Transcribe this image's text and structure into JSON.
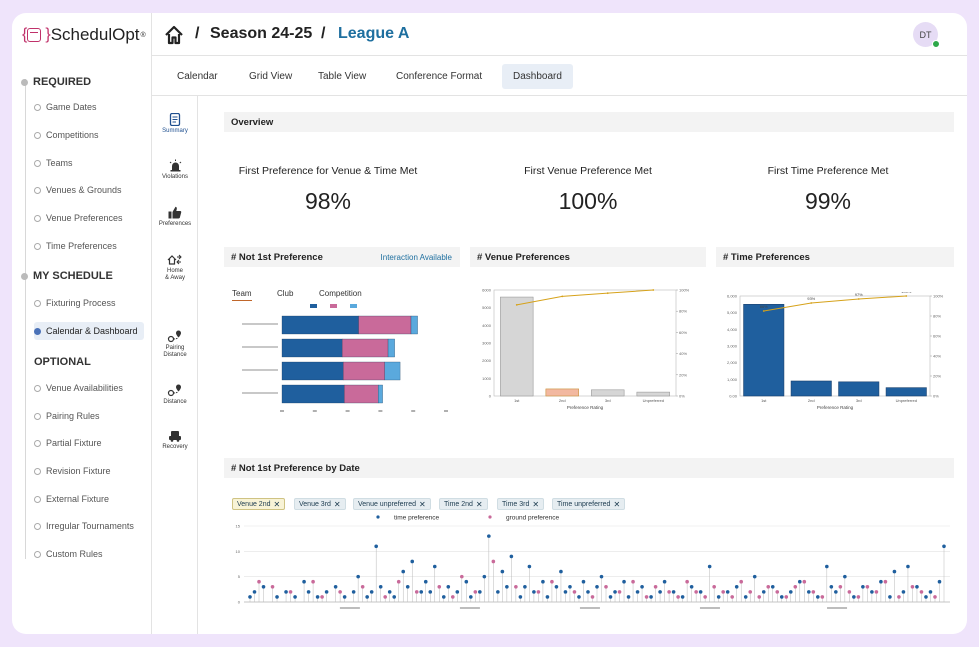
{
  "app": {
    "brand": "SchedulOpt",
    "brand_mark": "®"
  },
  "header": {
    "season": "Season 24-25",
    "league": "League A",
    "separator": "/",
    "avatar": "DT"
  },
  "sidebar": {
    "required_label": "REQUIRED",
    "required": [
      "Game Dates",
      "Competitions",
      "Teams",
      "Venues & Grounds",
      "Venue Preferences",
      "Time Preferences"
    ],
    "schedule_label": "MY SCHEDULE",
    "schedule": [
      "Fixturing Process",
      "Calendar & Dashboard"
    ],
    "optional_label": "OPTIONAL",
    "optional": [
      "Venue Availabilities",
      "Pairing Rules",
      "Partial Fixture",
      "Revision Fixture",
      "External Fixture",
      "Irregular Tournaments",
      "Custom Rules"
    ]
  },
  "tabs": [
    "Calendar",
    "Grid View",
    "Table View",
    "Conference Format",
    "Dashboard"
  ],
  "active_tab": "Dashboard",
  "vnav": [
    {
      "label": "Summary",
      "icon": "document-icon"
    },
    {
      "label": "Violations",
      "icon": "alarm-icon"
    },
    {
      "label": "Preferences",
      "icon": "thumbs-up-icon"
    },
    {
      "label": "Home & Away",
      "icon": "home-away-icon"
    },
    {
      "label": "Pairing Distance",
      "icon": "pairing-distance-icon"
    },
    {
      "label": "Distance",
      "icon": "distance-icon"
    },
    {
      "label": "Recovery",
      "icon": "recovery-icon"
    }
  ],
  "overview": {
    "title": "Overview",
    "kpis": [
      {
        "label": "First Preference for Venue & Time Met",
        "value": "98%"
      },
      {
        "label": "First Venue Preference Met",
        "value": "100%"
      },
      {
        "label": "First Time Preference Met",
        "value": "99%"
      }
    ]
  },
  "not_first": {
    "title": "# Not 1st Preference",
    "extra": "Interaction Available",
    "subtabs": [
      "Team",
      "Club",
      "Competition"
    ],
    "active_subtab": "Team"
  },
  "venue_pref": {
    "title": "# Venue Preferences",
    "xlabel": "Preference Rating"
  },
  "time_pref": {
    "title": "# Time Preferences",
    "xlabel": "Preference Rating"
  },
  "by_date": {
    "title": "# Not 1st Preference by Date",
    "chips": [
      "Venue 2nd",
      "Venue 3rd",
      "Venue unpreferred",
      "Time 2nd",
      "Time 3rd",
      "Time unpreferred"
    ],
    "legend": [
      "time preference",
      "ground preference"
    ]
  },
  "colors": {
    "blue": "#1f5f9e",
    "pink": "#c96a9a",
    "light_blue": "#5aa9dd",
    "gold": "#d6a21a",
    "gray_bar": "#d6d6d6"
  },
  "chart_data": [
    {
      "type": "bar",
      "orientation": "horizontal",
      "stacked": true,
      "series": [
        {
          "values": [
            70,
            55,
            56,
            57
          ]
        },
        {
          "values": [
            48,
            42,
            38,
            31
          ]
        },
        {
          "values": [
            6,
            6,
            14,
            4
          ]
        }
      ],
      "xlim": [
        0,
        150
      ]
    },
    {
      "type": "bar",
      "categories": [
        "1st",
        "2nd",
        "3rd",
        "Unpreferred"
      ],
      "values": [
        5600,
        400,
        350,
        220
      ],
      "ylim": [
        0,
        6000
      ],
      "line": [
        86,
        94,
        97,
        100
      ],
      "y2lim": [
        0,
        100
      ],
      "bar_colors": [
        "#d6d6d6",
        "#f2b8a0",
        "#d6d6d6",
        "#d6d6d6"
      ],
      "xlabel": "Preference Rating",
      "yticks": [
        0,
        1000,
        2000,
        3000,
        4000,
        5000,
        6000
      ],
      "y2ticks": [
        "0%",
        "20%",
        "40%",
        "60%",
        "80%",
        "100%"
      ]
    },
    {
      "type": "bar",
      "categories": [
        "1st",
        "2nd",
        "3rd",
        "Unpreferred"
      ],
      "values": [
        5500,
        900,
        850,
        500
      ],
      "ylim": [
        0,
        6000
      ],
      "line": [
        85,
        93,
        97,
        100
      ],
      "y2lim": [
        0,
        100
      ],
      "bar_colors": [
        "#1f5f9e",
        "#1f5f9e",
        "#1f5f9e",
        "#1f5f9e"
      ],
      "xlabel": "Preference Rating",
      "line_labels": [
        "86%",
        "93%",
        "97%",
        "100%"
      ],
      "yticks": [
        "0.00",
        "1,000",
        "2,000",
        "3,000",
        "4,000",
        "5,000",
        "6,000"
      ],
      "y2ticks": [
        "0%",
        "20%",
        "40%",
        "60%",
        "80%",
        "100%"
      ]
    },
    {
      "type": "scatter",
      "series": [
        {
          "name": "time preference",
          "points": [
            [
              2,
              1
            ],
            [
              3,
              2
            ],
            [
              5,
              3
            ],
            [
              8,
              1
            ],
            [
              10,
              2
            ],
            [
              12,
              1
            ],
            [
              14,
              4
            ],
            [
              15,
              2
            ],
            [
              17,
              1
            ],
            [
              19,
              2
            ],
            [
              21,
              3
            ],
            [
              23,
              1
            ],
            [
              25,
              2
            ],
            [
              26,
              5
            ],
            [
              28,
              1
            ],
            [
              29,
              2
            ],
            [
              30,
              11
            ],
            [
              31,
              3
            ],
            [
              33,
              2
            ],
            [
              34,
              1
            ],
            [
              36,
              6
            ],
            [
              37,
              3
            ],
            [
              38,
              8
            ],
            [
              40,
              2
            ],
            [
              41,
              4
            ],
            [
              42,
              2
            ],
            [
              43,
              7
            ],
            [
              45,
              1
            ],
            [
              46,
              3
            ],
            [
              48,
              2
            ],
            [
              50,
              4
            ],
            [
              51,
              1
            ],
            [
              53,
              2
            ],
            [
              54,
              5
            ],
            [
              55,
              13
            ],
            [
              57,
              2
            ],
            [
              58,
              6
            ],
            [
              59,
              3
            ],
            [
              60,
              9
            ],
            [
              62,
              1
            ],
            [
              63,
              3
            ],
            [
              64,
              7
            ],
            [
              65,
              2
            ],
            [
              67,
              4
            ],
            [
              68,
              1
            ],
            [
              70,
              3
            ],
            [
              71,
              6
            ],
            [
              72,
              2
            ],
            [
              73,
              3
            ],
            [
              75,
              1
            ],
            [
              76,
              4
            ],
            [
              77,
              2
            ],
            [
              79,
              3
            ],
            [
              80,
              5
            ],
            [
              82,
              1
            ],
            [
              83,
              2
            ],
            [
              85,
              4
            ],
            [
              86,
              1
            ],
            [
              88,
              2
            ],
            [
              89,
              3
            ],
            [
              91,
              1
            ],
            [
              93,
              2
            ],
            [
              94,
              4
            ],
            [
              96,
              2
            ],
            [
              98,
              1
            ],
            [
              100,
              3
            ],
            [
              102,
              2
            ],
            [
              104,
              7
            ],
            [
              106,
              1
            ],
            [
              108,
              2
            ],
            [
              110,
              3
            ],
            [
              112,
              1
            ],
            [
              114,
              5
            ],
            [
              116,
              2
            ],
            [
              118,
              3
            ],
            [
              120,
              1
            ],
            [
              122,
              2
            ],
            [
              124,
              4
            ],
            [
              126,
              2
            ],
            [
              128,
              1
            ],
            [
              130,
              7
            ],
            [
              131,
              3
            ],
            [
              132,
              2
            ],
            [
              134,
              5
            ],
            [
              136,
              1
            ],
            [
              138,
              3
            ],
            [
              140,
              2
            ],
            [
              142,
              4
            ],
            [
              144,
              1
            ],
            [
              145,
              6
            ],
            [
              147,
              2
            ],
            [
              148,
              7
            ],
            [
              150,
              3
            ],
            [
              152,
              1
            ],
            [
              153,
              2
            ],
            [
              155,
              4
            ],
            [
              156,
              11
            ]
          ]
        },
        {
          "name": "ground preference",
          "points": [
            [
              4,
              4
            ],
            [
              7,
              3
            ],
            [
              11,
              2
            ],
            [
              16,
              4
            ],
            [
              18,
              1
            ],
            [
              22,
              2
            ],
            [
              27,
              3
            ],
            [
              32,
              1
            ],
            [
              35,
              4
            ],
            [
              39,
              2
            ],
            [
              44,
              3
            ],
            [
              47,
              1
            ],
            [
              49,
              5
            ],
            [
              52,
              2
            ],
            [
              56,
              8
            ],
            [
              61,
              3
            ],
            [
              66,
              2
            ],
            [
              69,
              4
            ],
            [
              74,
              2
            ],
            [
              78,
              1
            ],
            [
              81,
              3
            ],
            [
              84,
              2
            ],
            [
              87,
              4
            ],
            [
              90,
              1
            ],
            [
              92,
              3
            ],
            [
              95,
              2
            ],
            [
              97,
              1
            ],
            [
              99,
              4
            ],
            [
              101,
              2
            ],
            [
              103,
              1
            ],
            [
              105,
              3
            ],
            [
              107,
              2
            ],
            [
              109,
              1
            ],
            [
              111,
              4
            ],
            [
              113,
              2
            ],
            [
              115,
              1
            ],
            [
              117,
              3
            ],
            [
              119,
              2
            ],
            [
              121,
              1
            ],
            [
              123,
              3
            ],
            [
              125,
              4
            ],
            [
              127,
              2
            ],
            [
              129,
              1
            ],
            [
              133,
              3
            ],
            [
              135,
              2
            ],
            [
              137,
              1
            ],
            [
              139,
              3
            ],
            [
              141,
              2
            ],
            [
              143,
              4
            ],
            [
              146,
              1
            ],
            [
              149,
              3
            ],
            [
              151,
              2
            ],
            [
              154,
              1
            ]
          ]
        }
      ],
      "ylim": [
        0,
        15
      ],
      "yticks": [
        0,
        5,
        10,
        15
      ]
    }
  ]
}
